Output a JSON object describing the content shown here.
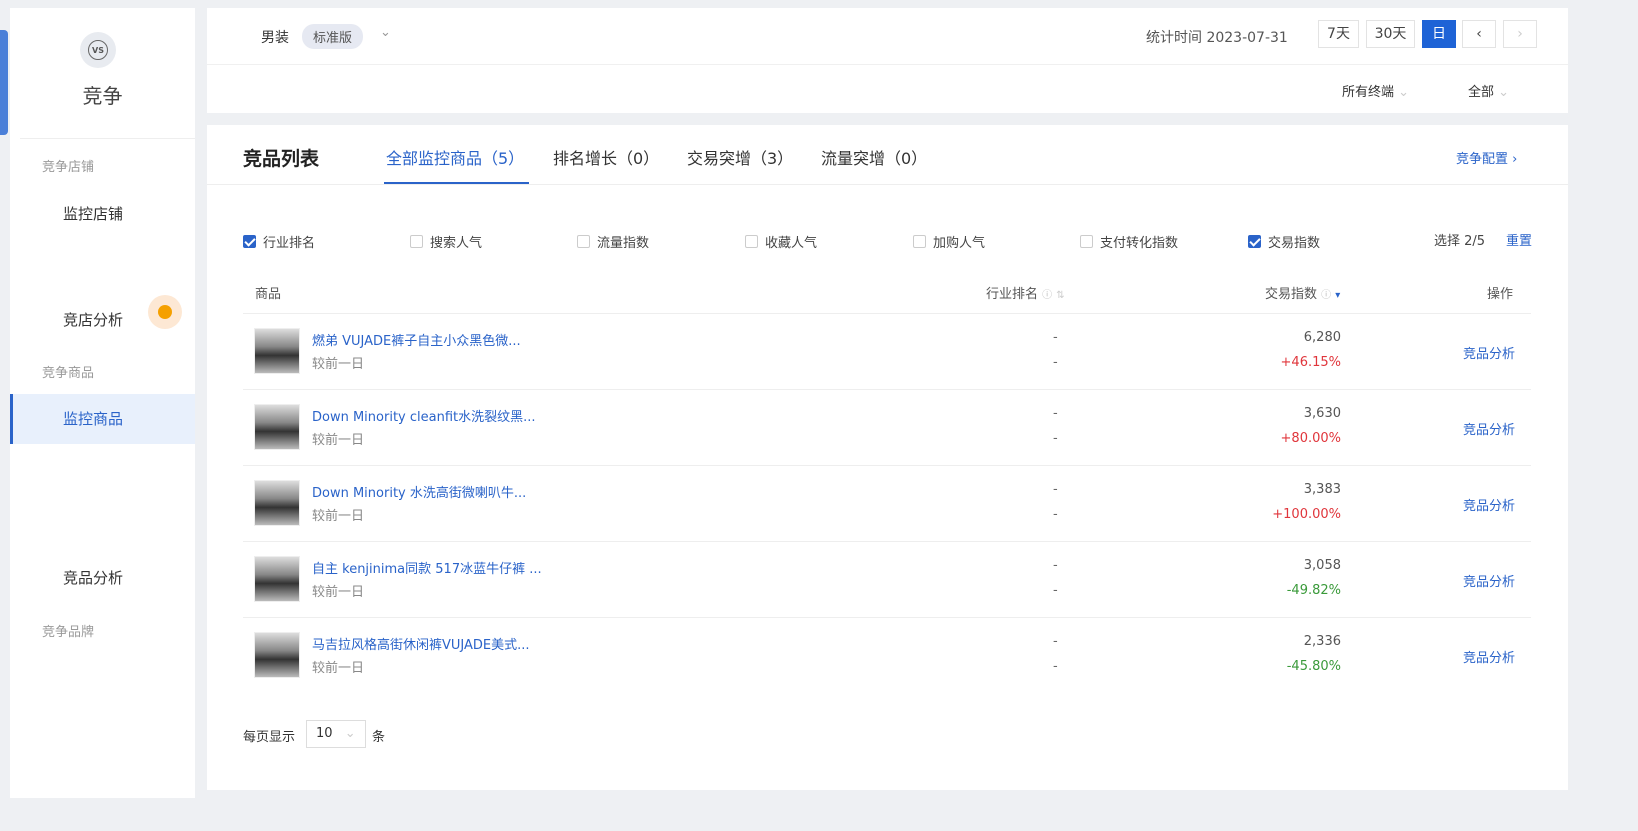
{
  "sidebar": {
    "brand": "竞争",
    "logo_text": "VS",
    "groups": [
      "竞争店铺",
      "竞争商品",
      "竞争品牌"
    ],
    "items": [
      "监控店铺",
      "竞店分析",
      "监控商品",
      "竞品分析"
    ]
  },
  "topbar": {
    "category": "男装",
    "edition": "标准版",
    "stat_time": "统计时间 2023-07-31",
    "ranges": [
      "7天",
      "30天",
      "日"
    ],
    "prev": "‹",
    "next": "›",
    "terminal": "所有终端",
    "scope": "全部"
  },
  "main": {
    "title": "竞品列表",
    "tabs": [
      "全部监控商品（5）",
      "排名增长（0）",
      "交易突增（3）",
      "流量突增（0）"
    ],
    "config": "竞争配置 ›",
    "metrics": [
      {
        "label": "行业排名",
        "checked": true
      },
      {
        "label": "搜索人气",
        "checked": false
      },
      {
        "label": "流量指数",
        "checked": false
      },
      {
        "label": "收藏人气",
        "checked": false
      },
      {
        "label": "加购人气",
        "checked": false
      },
      {
        "label": "支付转化指数",
        "checked": false
      },
      {
        "label": "交易指数",
        "checked": true
      }
    ],
    "select_count": "选择 2/5",
    "reset": "重置",
    "headers": {
      "product": "商品",
      "rank": "行业排名",
      "trade": "交易指数",
      "action": "操作"
    },
    "rows": [
      {
        "name": "燃弟 VUJADE裤子自主小众黑色微...",
        "sub": "较前一日",
        "rank": "-",
        "rank_change": "-",
        "value": "6,280",
        "change": "+46.15%",
        "dir": "up",
        "action": "竞品分析"
      },
      {
        "name": "Down Minority cleanfit水洗裂纹黑...",
        "sub": "较前一日",
        "rank": "-",
        "rank_change": "-",
        "value": "3,630",
        "change": "+80.00%",
        "dir": "up",
        "action": "竞品分析"
      },
      {
        "name": "Down Minority 水洗高街微喇叭牛...",
        "sub": "较前一日",
        "rank": "-",
        "rank_change": "-",
        "value": "3,383",
        "change": "+100.00%",
        "dir": "up",
        "action": "竞品分析"
      },
      {
        "name": "自主 kenjinima同款 517冰蓝牛仔裤 ...",
        "sub": "较前一日",
        "rank": "-",
        "rank_change": "-",
        "value": "3,058",
        "change": "-49.82%",
        "dir": "down",
        "action": "竞品分析"
      },
      {
        "name": "马吉拉风格高街休闲裤VUJADE美式...",
        "sub": "较前一日",
        "rank": "-",
        "rank_change": "-",
        "value": "2,336",
        "change": "-45.80%",
        "dir": "down",
        "action": "竞品分析"
      }
    ],
    "page_size_label": "每页显示",
    "page_size": "10",
    "page_size_unit": "条"
  }
}
